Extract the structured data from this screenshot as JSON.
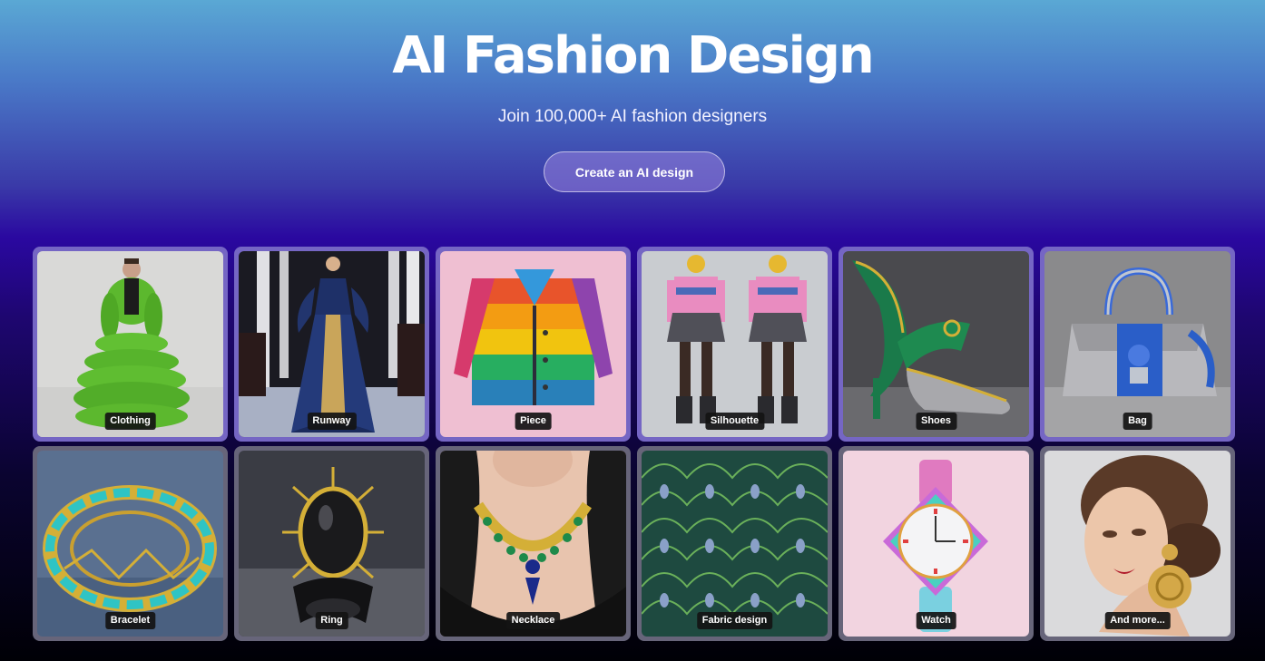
{
  "hero": {
    "title": "AI Fashion Design",
    "subtitle": "Join 100,000+ AI fashion designers",
    "cta_label": "Create an AI design"
  },
  "gallery": {
    "items": [
      {
        "label": "Clothing",
        "icon": "green-puffer-outfit-image"
      },
      {
        "label": "Runway",
        "icon": "runway-gown-image"
      },
      {
        "label": "Piece",
        "icon": "rainbow-coat-image"
      },
      {
        "label": "Silhouette",
        "icon": "streetwear-silhouette-image"
      },
      {
        "label": "Shoes",
        "icon": "green-heel-shoe-image"
      },
      {
        "label": "Bag",
        "icon": "handbag-image"
      },
      {
        "label": "Bracelet",
        "icon": "turquoise-bracelet-image"
      },
      {
        "label": "Ring",
        "icon": "black-stone-ring-image"
      },
      {
        "label": "Necklace",
        "icon": "emerald-necklace-image"
      },
      {
        "label": "Fabric design",
        "icon": "peacock-fabric-image"
      },
      {
        "label": "Watch",
        "icon": "iridescent-watch-image"
      },
      {
        "label": "And more...",
        "icon": "model-earring-image"
      }
    ]
  },
  "colors": {
    "card_border_top": "#7566c4",
    "card_border_bottom": "#67657a",
    "label_bg": "#141414"
  }
}
